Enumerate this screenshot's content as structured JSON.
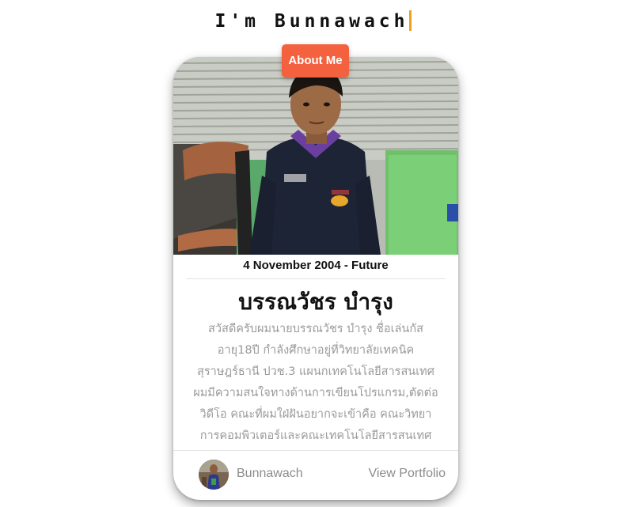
{
  "header": {
    "typed_title": "I'm Bunnawach"
  },
  "card": {
    "badge_label": "About Me",
    "date_range": "4 November 2004 - Future",
    "name": "บรรณวัชร บำรุง",
    "bio_lines": [
      "สวัสดีครับผมนายบรรณวัชร บำรุง ชื่อเล่นกัส",
      "อายุ18ปี กำลังศึกษาอยู่ที่วิทยาลัยเทคนิค",
      "สุราษฎร์ธานี ปวช.3 แผนกเทคโนโลยีสารสนเทศ",
      "ผมมีความสนใจทางด้านการเขียนโปรแกรม,ตัดต่อ",
      "วิดีโอ คณะที่ผมใฝ่ฝันอยากจะเข้าคือ คณะวิทยา",
      "การคอมพิวเตอร์และคณะเทคโนโลยีสารสนเทศ"
    ],
    "footer": {
      "username": "Bunnawach",
      "link_label": "View Portfolio"
    }
  },
  "colors": {
    "accent": "#f4613f",
    "caret": "#f0a020",
    "muted_text": "#9a9a9a"
  }
}
